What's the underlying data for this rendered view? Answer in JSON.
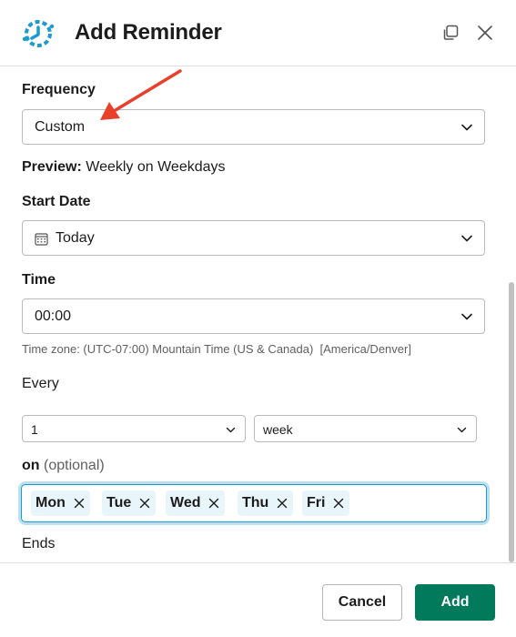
{
  "header": {
    "title": "Add Reminder",
    "logo_icon": "reminder-clock-icon",
    "popout_icon": "popout-window-icon",
    "close_icon": "close-icon"
  },
  "form": {
    "frequency": {
      "label": "Frequency",
      "value": "Custom"
    },
    "preview": {
      "label": "Preview:",
      "value": "Weekly on Weekdays"
    },
    "start_date": {
      "label": "Start Date",
      "value": "Today",
      "icon": "calendar-icon"
    },
    "time": {
      "label": "Time",
      "value": "00:00",
      "timezone": "Time zone: (UTC-07:00) Mountain Time (US & Canada)  [America/Denver]"
    },
    "every": {
      "label": "Every",
      "count": "1",
      "unit": "week"
    },
    "on": {
      "label": "on",
      "optional": "(optional)",
      "days": [
        "Mon",
        "Tue",
        "Wed",
        "Thu",
        "Fri"
      ]
    },
    "ends": {
      "label": "Ends"
    }
  },
  "footer": {
    "cancel_label": "Cancel",
    "add_label": "Add"
  },
  "colors": {
    "accent_green": "#007a5a",
    "focus_blue": "#1d9bd1",
    "chip_bg": "#e8f5fa",
    "annotation_red": "#e8402a",
    "logo_blue": "#1d9bd1"
  }
}
